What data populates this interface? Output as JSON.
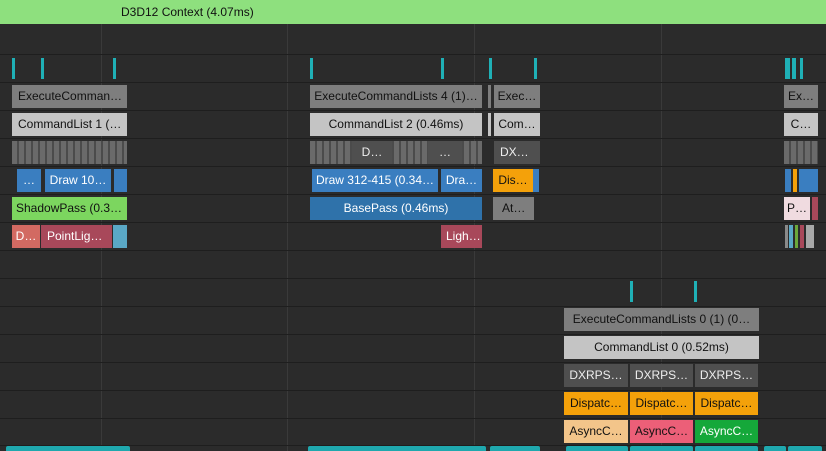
{
  "context": {
    "title": "D3D12 Context (4.07ms)"
  },
  "colors": {
    "background": "#2b2b2b",
    "context_bar": "#8ee07e",
    "execute": "#7e7e7e",
    "commandlist": "#c4c4c4",
    "dark_block": "#4f4f4f",
    "draw": "#3a7ec0",
    "basepass": "#2f72aa",
    "shadowpass": "#7cd65f",
    "pointlight": "#a8485a",
    "dispatch": "#f4a10a",
    "async1": "#f3c58a",
    "async2": "#ec5f78",
    "async3": "#15a83a",
    "marker": "#1fb0b6"
  },
  "graphics_queue": {
    "execute": [
      "ExecuteComman…",
      "ExecuteCommandLists 4 (1)…",
      "Exec…",
      "Ex…"
    ],
    "commandlist": [
      "CommandList 1 (…",
      "CommandList 2 (0.46ms)",
      "Com…",
      "C…"
    ],
    "subblocks": [
      "D…",
      "…",
      "DX…"
    ],
    "draws": [
      "…",
      "Draw 10…",
      "Draw 312-415 (0.34…",
      "Dra…",
      "Dis…"
    ],
    "passes": [
      "ShadowPass (0.3…",
      "BasePass (0.46ms)",
      "At…",
      "P…"
    ],
    "lights": [
      "D…",
      "PointLig…",
      "Ligh…"
    ]
  },
  "compute_queue": {
    "execute": "ExecuteCommandLists 0 (1) (0…",
    "commandlist": "CommandList 0 (0.52ms)",
    "dxrps": [
      "DXRPS…",
      "DXRPS…",
      "DXRPS…"
    ],
    "dispatch": [
      "Dispatc…",
      "Dispatc…",
      "Dispatc…"
    ],
    "async": [
      "AsyncC…",
      "AsyncC…",
      "AsyncC…"
    ]
  }
}
